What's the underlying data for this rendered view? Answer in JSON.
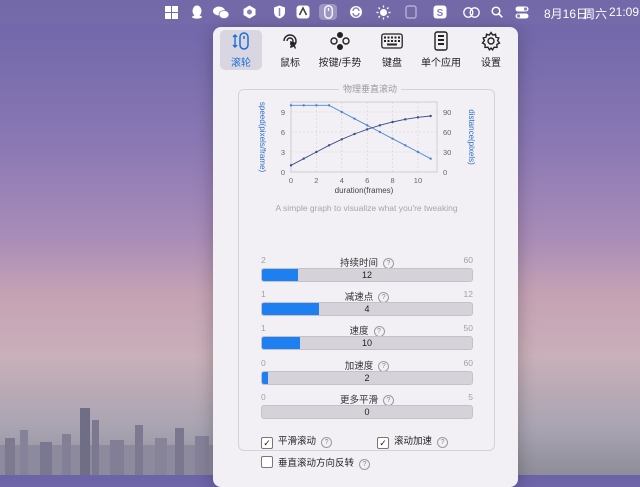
{
  "menubar": {
    "date": "8月16日",
    "weekday": "周六",
    "time": "21:09"
  },
  "toolbar": {
    "items": [
      {
        "label": "滚轮",
        "icon": "scroll-wheel-icon",
        "active": true
      },
      {
        "label": "鼠标",
        "icon": "mouse-pointer-icon",
        "active": false
      },
      {
        "label": "按键/手势",
        "icon": "buttons-gesture-icon",
        "active": false
      },
      {
        "label": "键盘",
        "icon": "keyboard-icon",
        "active": false
      },
      {
        "label": "单个应用",
        "icon": "single-app-icon",
        "active": false
      },
      {
        "label": "设置",
        "icon": "gear-icon",
        "active": false
      }
    ]
  },
  "section": {
    "title": "物理垂直滚动",
    "caption": "A simple graph to visualize what you're tweaking"
  },
  "chart_data": {
    "type": "line",
    "xlabel": "duration(frames)",
    "ylabel_left": "speed(pixels/frame)",
    "ylabel_right": "distance(pixels)",
    "x_ticks": [
      0,
      2,
      4,
      6,
      8,
      10
    ],
    "y_left_ticks": [
      0,
      3,
      6,
      9
    ],
    "y_right_ticks": [
      0,
      30,
      60,
      90
    ],
    "xlim": [
      0,
      11.5
    ],
    "ylim_left": [
      0,
      10.5
    ],
    "ylim_right": [
      0,
      105
    ],
    "series": [
      {
        "axis": "left",
        "x": [
          0,
          1,
          2,
          3,
          4,
          5,
          6,
          7,
          8,
          9,
          10,
          11
        ],
        "values": [
          10,
          10,
          10,
          10,
          9,
          8,
          7,
          6,
          5,
          4,
          3,
          2
        ]
      },
      {
        "axis": "right",
        "x": [
          0,
          1,
          2,
          3,
          4,
          5,
          6,
          7,
          8,
          9,
          10,
          11
        ],
        "values": [
          10,
          20,
          30,
          40,
          49,
          57,
          64,
          70,
          75,
          79,
          82,
          84
        ]
      }
    ],
    "colors": {
      "speed": "#4b87d6",
      "distance": "#3a4f8c"
    },
    "grid": true
  },
  "sliders": [
    {
      "name": "duration",
      "label": "持续时间",
      "min": "2",
      "max": "60",
      "value": "12",
      "fraction": 0.17
    },
    {
      "name": "decel-point",
      "label": "减速点",
      "min": "1",
      "max": "12",
      "value": "4",
      "fraction": 0.27
    },
    {
      "name": "speed",
      "label": "速度",
      "min": "1",
      "max": "50",
      "value": "10",
      "fraction": 0.18
    },
    {
      "name": "acceleration",
      "label": "加速度",
      "min": "0",
      "max": "60",
      "value": "2",
      "fraction": 0.03
    },
    {
      "name": "smoothing",
      "label": "更多平滑",
      "min": "0",
      "max": "5",
      "value": "0",
      "fraction": 0.0
    }
  ],
  "checkboxes": [
    {
      "label": "平滑滚动",
      "checked": true
    },
    {
      "label": "滚动加速",
      "checked": true
    },
    {
      "label": "垂直滚动方向反转",
      "checked": false
    }
  ]
}
